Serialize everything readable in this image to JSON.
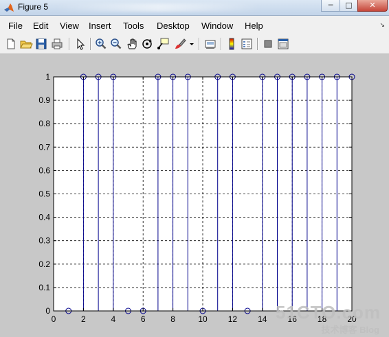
{
  "window": {
    "title": "Figure 5",
    "controls": {
      "minimize": "─",
      "maximize": "□",
      "close": "✕"
    }
  },
  "menu": {
    "items": [
      "File",
      "Edit",
      "View",
      "Insert",
      "Tools",
      "Desktop",
      "Window",
      "Help"
    ],
    "dock_glyph": "↘"
  },
  "toolbar": {
    "icons": [
      "new-figure-icon",
      "open-file-icon",
      "save-icon",
      "print-icon",
      "edit-plot-arrow-icon",
      "zoom-in-icon",
      "zoom-out-icon",
      "pan-hand-icon",
      "rotate-3d-icon",
      "data-cursor-icon",
      "brush-icon",
      "brush-dropdown-icon",
      "link-plot-icon",
      "insert-colorbar-icon",
      "insert-legend-icon",
      "hide-plot-tools-icon",
      "show-plot-tools-icon"
    ]
  },
  "colors": {
    "stem": "#00008b",
    "axes_bg": "#ffffff",
    "figure_bg": "#c8c8c8",
    "grid": "#000000"
  },
  "chart_data": {
    "type": "stem",
    "x": [
      1,
      2,
      3,
      4,
      5,
      6,
      7,
      8,
      9,
      10,
      11,
      12,
      13,
      14,
      15,
      16,
      17,
      18,
      19,
      20
    ],
    "values": [
      0,
      1,
      1,
      1,
      0,
      0,
      1,
      1,
      1,
      0,
      1,
      1,
      0,
      1,
      1,
      1,
      1,
      1,
      1,
      1
    ],
    "xlim": [
      0,
      20
    ],
    "ylim": [
      0,
      1
    ],
    "xticks": [
      "0",
      "2",
      "4",
      "6",
      "8",
      "10",
      "12",
      "14",
      "16",
      "18",
      "20"
    ],
    "yticks": [
      "0",
      "0.1",
      "0.2",
      "0.3",
      "0.4",
      "0.5",
      "0.6",
      "0.7",
      "0.8",
      "0.9",
      "1"
    ],
    "grid": true,
    "marker": "circle-open"
  },
  "watermark": {
    "main": "51CTO.com",
    "sub": "技术博客 Blog"
  }
}
